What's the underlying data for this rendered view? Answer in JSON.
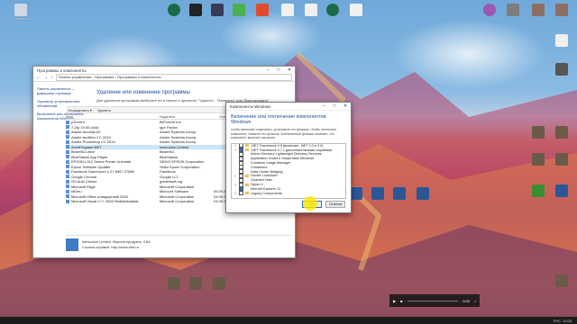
{
  "window": {
    "title": "Программы и компоненты",
    "breadcrumb": "Панель управления › Программы › Программы и компоненты",
    "left_links": [
      "Панель управления — домашняя страница",
      "Просмотр установленных обновлений",
      "Включение или отключение компонентов Windows"
    ],
    "heading": "Удаление или изменение программы",
    "subtitle": "Для удаления программы выберите ее в списке и щелкните \"Удалить\", \"Изменить\" или \"Восстановить\".",
    "toolbar": [
      "Упорядочить ▾",
      "Удалить"
    ],
    "columns": [
      "Имя",
      "Издатель",
      "Устан...",
      "Размер"
    ],
    "rows": [
      {
        "name": "µTorrent",
        "publisher": "BitTorrent Inc."
      },
      {
        "name": "7-Zip 19.00 (x64)",
        "publisher": "Igor Pavlov"
      },
      {
        "name": "Adobe Acrobat DC",
        "publisher": "Adobe Systems Incorp."
      },
      {
        "name": "Adobe Audition CC 2019",
        "publisher": "Adobe Systems Incorp."
      },
      {
        "name": "Adobe Photoshop CC 2019",
        "publisher": "Adobe Systems Incorp."
      },
      {
        "name": "AnvirProgram.NET",
        "publisher": "Isetsunice Limited",
        "selected": true
      },
      {
        "name": "BeamNG.drive",
        "publisher": "BeamNG"
      },
      {
        "name": "BlueStacks App Player",
        "publisher": "BlueStacks"
      },
      {
        "name": "EPSON L312 Series Printer Uninstall",
        "publisher": "SEIKO EPSON Corporation"
      },
      {
        "name": "Epson Software Updater",
        "publisher": "Seiko Epson Corporation"
      },
      {
        "name": "Facebook Gameroom 1.27.6967.27686",
        "publisher": "Facebook"
      },
      {
        "name": "Google Chrome",
        "publisher": "Google LLC"
      },
      {
        "name": "GS Auto Clicker",
        "publisher": "goldensoft.org"
      },
      {
        "name": "Microsoft Edge",
        "publisher": "Microsoft Corporation"
      },
      {
        "name": "MEmu",
        "publisher": "Microvirt Software"
      },
      {
        "name": "Microsoft Office стандартный 2016",
        "publisher": "Microsoft Corporation"
      },
      {
        "name": "Microsoft Visual C++ 2005 Redistributable",
        "publisher": "Microsoft Corporation"
      }
    ],
    "row_dates": [
      "",
      "",
      "",
      "",
      "",
      "",
      "",
      "",
      "",
      "",
      "",
      "",
      "",
      "",
      "05.05.2019",
      "04.05.2019",
      "04.05.2019"
    ],
    "row_sizes": [
      "",
      "",
      "",
      "",
      "",
      "",
      "",
      "",
      "",
      "",
      "",
      "",
      "",
      "",
      "1,66 M",
      "",
      "9,63 M"
    ],
    "bottom": {
      "name": "Isetsunice Limited",
      "version_label": "Версия продукта:",
      "version": "4.84",
      "link_label": "Ссылка справки:",
      "link": "http://www.ebit.ru"
    }
  },
  "dialog": {
    "title": "Компоненты Windows",
    "heading": "Включение или отключение компонентов Windows",
    "text": "Чтобы включить компонент, установите его флажок. Чтобы отключить компонент, снимите его флажок. Затемненный флажок означает, что компонент включен частично.",
    "items": [
      {
        "label": ".NET Framework 3.5 (включает .NET 2.0 и 3.0)",
        "expand": "+",
        "state": "none",
        "folder": true
      },
      {
        "label": ".NET Framework 4.7 с дополнительными службами",
        "expand": "+",
        "state": "part",
        "folder": true
      },
      {
        "label": "Active Directory Lightweight Directory Services",
        "expand": "",
        "state": "none",
        "folder": false
      },
      {
        "label": "Application Guard в Защитнике Windows",
        "expand": "",
        "state": "none",
        "folder": false
      },
      {
        "label": "Container Image Manager",
        "expand": "",
        "state": "none",
        "folder": false
      },
      {
        "label": "Containers",
        "expand": "",
        "state": "none",
        "folder": false
      },
      {
        "label": "Data Center Bridging",
        "expand": "",
        "state": "none",
        "folder": false
      },
      {
        "label": "Device Lockdown",
        "expand": "+",
        "state": "none",
        "folder": true
      },
      {
        "label": "Guarded Host",
        "expand": "",
        "state": "none",
        "folder": false
      },
      {
        "label": "Hyper-V",
        "expand": "+",
        "state": "none",
        "folder": true
      },
      {
        "label": "Internet Explorer 11",
        "expand": "",
        "state": "part",
        "folder": false
      },
      {
        "label": "Legacy Components",
        "expand": "+",
        "state": "none",
        "folder": true
      }
    ],
    "ok": "ОК",
    "cancel": "Отмена"
  },
  "media": {
    "time": "0:00"
  },
  "taskbar": {
    "lang": "РУС",
    "time": "11:03"
  },
  "desktop_icons": [
    {
      "id": "i1",
      "label": "Корзина",
      "color": "#cfd8e6"
    },
    {
      "id": "i2",
      "label": "",
      "color": "#2e6a9e"
    },
    {
      "id": "i3",
      "label": "",
      "color": "#3aa0e0"
    },
    {
      "id": "i4",
      "label": "",
      "color": "#333333"
    },
    {
      "id": "i5",
      "label": "",
      "color": "#2e8b57"
    },
    {
      "id": "i6",
      "label": "",
      "color": "#b8d94a"
    },
    {
      "id": "i7",
      "label": "",
      "color": "#e34a2c"
    },
    {
      "id": "i8",
      "label": "",
      "color": "#e0e0e0"
    },
    {
      "id": "i9",
      "label": "",
      "color": "#1b6b4a"
    },
    {
      "id": "i10",
      "label": "",
      "color": "#e0e0e0"
    },
    {
      "id": "i11",
      "label": "",
      "color": "#1b6b4a"
    },
    {
      "id": "i12",
      "label": "",
      "color": "#f0f0f0"
    },
    {
      "id": "i13",
      "label": "",
      "color": "#9b59b6"
    },
    {
      "id": "i14",
      "label": "",
      "color": "#7d7d7d"
    },
    {
      "id": "i15",
      "label": "",
      "color": "#8d6e63"
    }
  ]
}
